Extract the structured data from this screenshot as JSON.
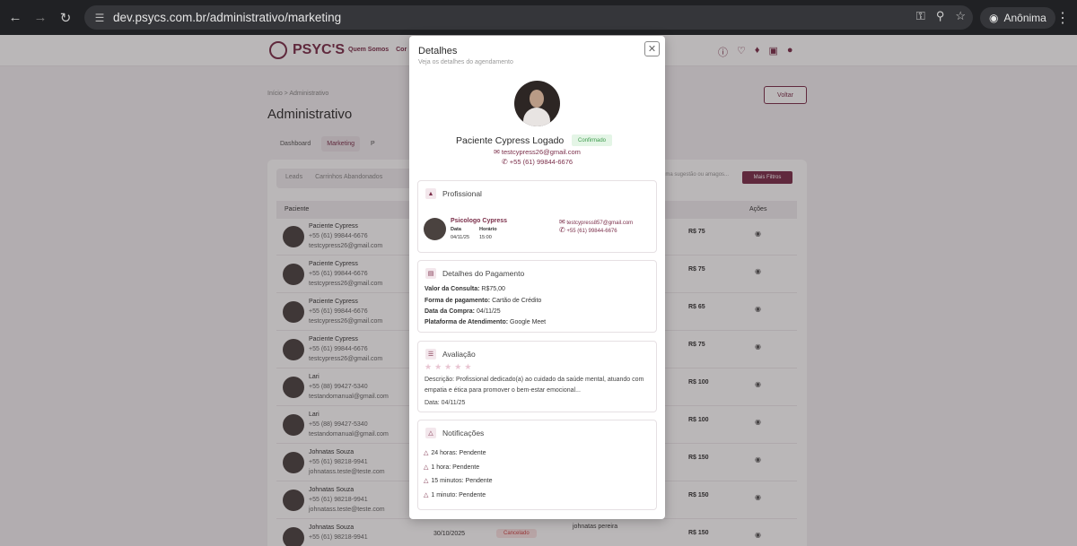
{
  "browser": {
    "url": "dev.psycs.com.br/administrativo/marketing",
    "incognito_label": "Anônima"
  },
  "site": {
    "logo_text": "PSYC'S",
    "nav": [
      "Quem Somos",
      "Cor"
    ],
    "breadcrumb": "Início > Administrativo",
    "page_title": "Administrativo",
    "back_label": "Voltar",
    "tabs": [
      "Dashboard",
      "Marketing",
      "P"
    ],
    "subtabs": [
      "Leads",
      "Carrinhos Abandonados"
    ],
    "filter_placeholder": "uma sugestão ou amagos...",
    "filters_label": "Mais Filtros",
    "table_headers": {
      "patient": "Paciente",
      "actions": "Ações"
    },
    "rows": [
      {
        "name": "Paciente Cypress",
        "phone": "+55 (61) 99844-6676",
        "email": "testcypress26@gmail.com",
        "price": "R$ 75"
      },
      {
        "name": "Paciente Cypress",
        "phone": "+55 (61) 99844-6676",
        "email": "testcypress26@gmail.com",
        "price": "R$ 75"
      },
      {
        "name": "Paciente Cypress",
        "phone": "+55 (61) 99844-6676",
        "email": "testcypress26@gmail.com",
        "price": "R$ 65"
      },
      {
        "name": "Paciente Cypress",
        "phone": "+55 (61) 99844-6676",
        "email": "testcypress26@gmail.com",
        "price": "R$ 75"
      },
      {
        "name": "Lari",
        "phone": "+55 (88) 99427-5340",
        "email": "testandomanual@gmail.com",
        "price": "R$ 100"
      },
      {
        "name": "Lari",
        "phone": "+55 (88) 99427-5340",
        "email": "testandomanual@gmail.com",
        "price": "R$ 100"
      },
      {
        "name": "Johnatas Souza",
        "phone": "+55 (61) 98218-9941",
        "email": "johnatass.teste@teste.com",
        "price": "R$ 150"
      },
      {
        "name": "Johnatas Souza",
        "phone": "+55 (61) 98218-9941",
        "email": "johnatass.teste@teste.com",
        "price": "R$ 150"
      },
      {
        "name": "Johnatas Souza",
        "phone": "+55 (61) 98218-9941",
        "email": "",
        "price": "R$ 150",
        "date": "30/10/2025",
        "status": "Cancelado",
        "professional": "johnatas pereira"
      }
    ]
  },
  "modal": {
    "title": "Detalhes",
    "subtitle": "Veja os detalhes do agendamento",
    "patient_name": "Paciente Cypress Logado",
    "status": "Confirmado",
    "email": "testcypress26@gmail.com",
    "phone": "+55 (61) 99844-6676",
    "professional": {
      "title": "Profissional",
      "name": "Psicologo Cypress",
      "date_label": "Data",
      "time_label": "Horário",
      "date": "04/11/25",
      "time": "15:00",
      "email": "testcypress857@gmail.com",
      "phone": "+55 (61) 99844-6676"
    },
    "payment": {
      "title": "Detalhes do Pagamento",
      "lines": [
        {
          "label": "Valor da Consulta:",
          "value": "R$75,00"
        },
        {
          "label": "Forma de pagamento:",
          "value": "Cartão de Crédito"
        },
        {
          "label": "Data da Compra:",
          "value": "04/11/25"
        },
        {
          "label": "Plataforma de Atendimento:",
          "value": "Google Meet"
        }
      ]
    },
    "review": {
      "title": "Avaliação",
      "rating": 0,
      "description": "Descrição: Profissional dedicado(a) ao cuidado da saúde mental, atuando com empatia e ética para promover o bem-estar emocional...",
      "date": "Data: 04/11/25"
    },
    "notifications": {
      "title": "Notificações",
      "items": [
        "24 horas: Pendente",
        "1 hora: Pendente",
        "15 minutos: Pendente",
        "1 minuto: Pendente"
      ]
    }
  }
}
